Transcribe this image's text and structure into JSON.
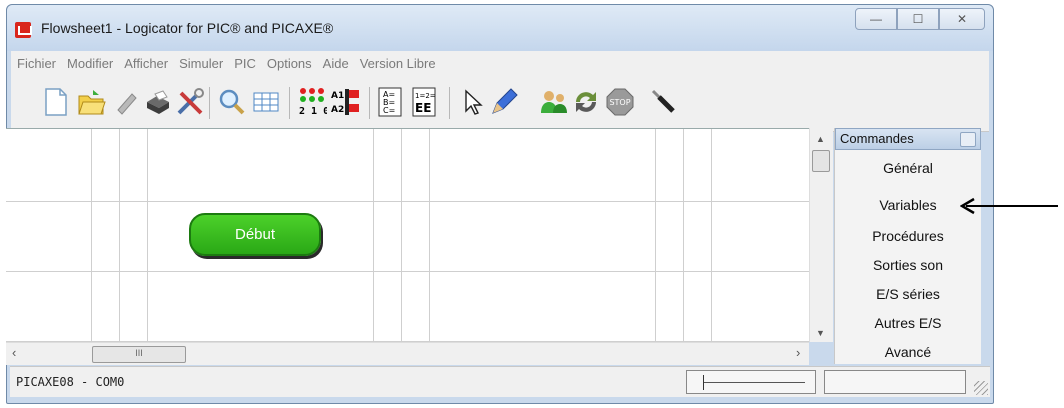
{
  "window": {
    "title": "Flowsheet1 - Logicator for PIC® and PICAXE®",
    "controls": {
      "minimize": "—",
      "maximize": "☐",
      "close": "✕"
    }
  },
  "menu": [
    "Fichier",
    "Modifier",
    "Afficher",
    "Simuler",
    "PIC",
    "Options",
    "Aide",
    "Version Libre"
  ],
  "toolbar": {
    "buttons": [
      "new-file-icon",
      "open-folder-icon",
      "chip-icon",
      "print-icon",
      "tools-icon",
      "zoom-icon",
      "grid-icon",
      "outputs-icon",
      "inputs-analog-icon",
      "variables-icon",
      "expression-icon",
      "select-arrow-icon",
      "pencil-icon",
      "people-icon",
      "refresh-icon",
      "stop-icon",
      "cable-icon"
    ],
    "stop_label": "STOP",
    "inputs_labels": [
      "A1",
      "A2"
    ],
    "outputs_digits": "2 1 0",
    "vars_labels": [
      "A=",
      "B=",
      "C="
    ],
    "expr_top": "1=2=",
    "expr_bottom": "EE"
  },
  "canvas": {
    "start_node_label": "Début",
    "node_color": "#33bb1e"
  },
  "scrollbars": {
    "h_thumb_grip": "III",
    "left_arrow": "‹",
    "right_arrow": "›",
    "up_arrow": "▲",
    "down_arrow": "▼"
  },
  "commands_panel": {
    "header": "Commandes",
    "items": [
      "Général",
      "Variables",
      "Procédures",
      "Sorties son",
      "E/S séries",
      "Autres E/S",
      "Avancé"
    ]
  },
  "status": {
    "left_text": "PICAXE08 - COM0"
  }
}
